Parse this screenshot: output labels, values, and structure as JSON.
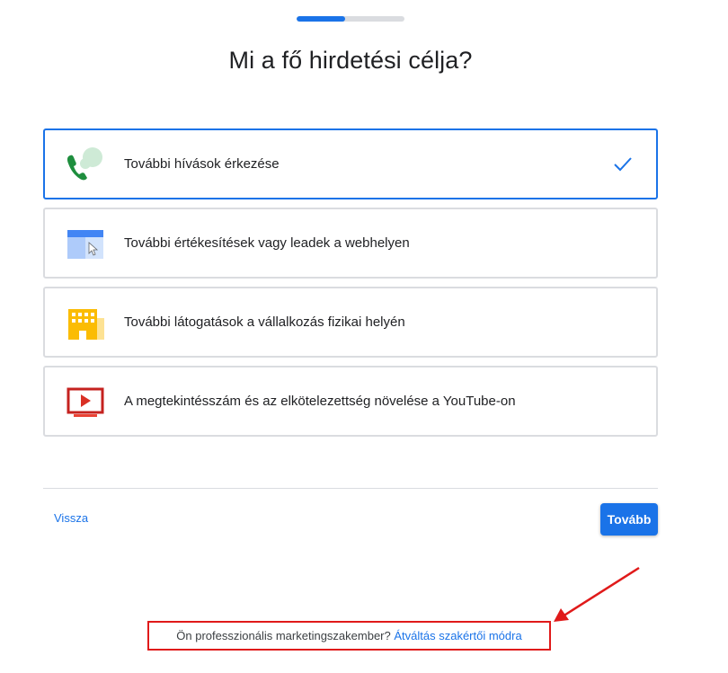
{
  "progress": {
    "fraction": 0.45
  },
  "page": {
    "title": "Mi a fő hirdetési célja?"
  },
  "options": [
    {
      "label": "További hívások érkezése",
      "icon": "phone-chat-icon",
      "selected": true
    },
    {
      "label": "További értékesítések vagy leadek a webhelyen",
      "icon": "webpage-cursor-icon",
      "selected": false
    },
    {
      "label": "További látogatások a vállalkozás fizikai helyén",
      "icon": "storefront-building-icon",
      "selected": false
    },
    {
      "label": "A megtekintésszám és az elkötelezettség növelése a YouTube-on",
      "icon": "youtube-play-icon",
      "selected": false
    }
  ],
  "footer": {
    "back_label": "Vissza",
    "next_label": "Tovább"
  },
  "expert": {
    "question": "Ön professzionális marketingszakember?",
    "link": "Átváltás szakértői módra"
  },
  "colors": {
    "accent": "#1a73e8",
    "annotation_red": "#e01a1a"
  }
}
